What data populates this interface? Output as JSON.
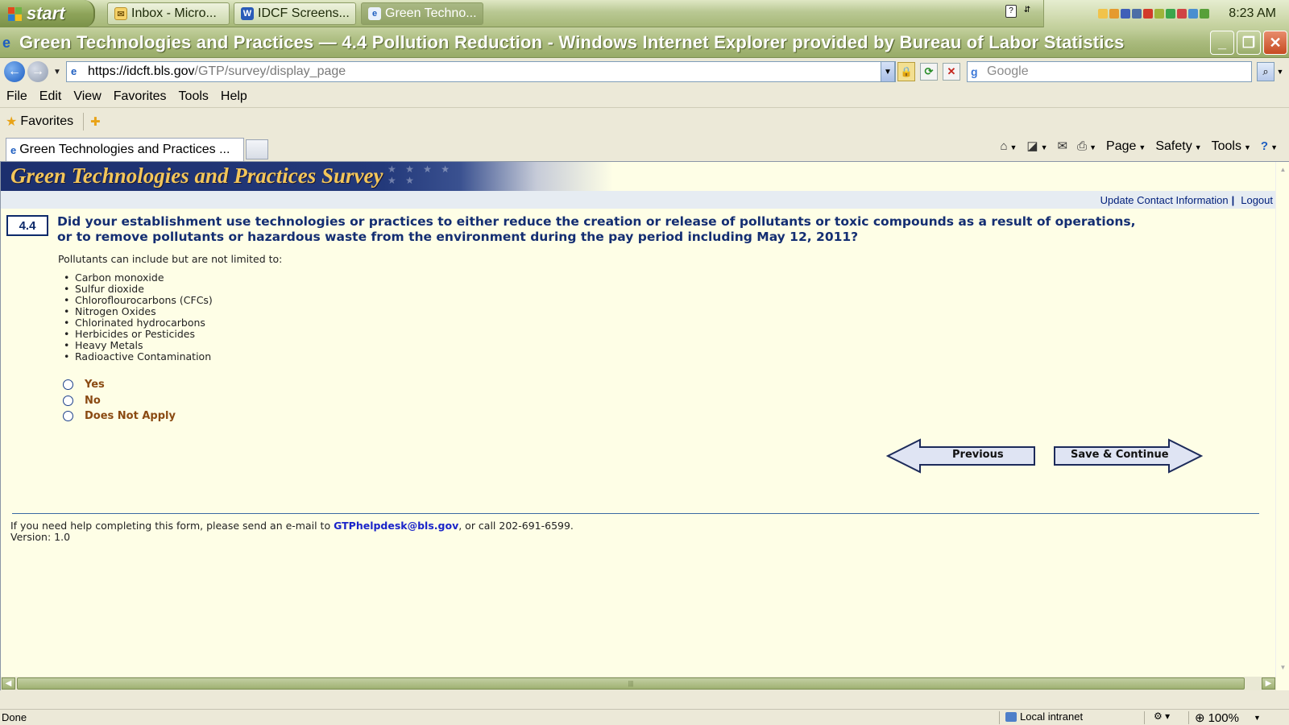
{
  "taskbar": {
    "start_label": "start",
    "tasks": [
      {
        "label": "Inbox - Micro...",
        "icon": "outlook-icon"
      },
      {
        "label": "IDCF Screens...",
        "icon": "word-icon"
      },
      {
        "label": "Green Techno...",
        "icon": "ie-icon"
      }
    ],
    "clock": "8:23 AM"
  },
  "window": {
    "title": "Green Technologies and Practices — 4.4 Pollution Reduction - Windows Internet Explorer provided by Bureau of Labor Statistics"
  },
  "address": {
    "host": "https://idcft.bls.gov",
    "path": "/GTP/survey/display_page",
    "search_placeholder": "Google"
  },
  "menu": [
    "File",
    "Edit",
    "View",
    "Favorites",
    "Tools",
    "Help"
  ],
  "favorites_label": "Favorites",
  "tab_label": "Green Technologies and Practices ...",
  "command_bar": {
    "page": "Page",
    "safety": "Safety",
    "tools": "Tools"
  },
  "page": {
    "banner_title": "Green Technologies and Practices Survey",
    "update_contact": "Update Contact Information",
    "pipe": "|",
    "logout": "Logout",
    "question_number": "4.4",
    "question_text": "Did your establishment use technologies or practices to either reduce the creation or release of pollutants or toxic compounds as a result of operations, or to remove pollutants or hazardous waste from the environment during the pay period including May 12, 2011?",
    "pollutants_intro": "Pollutants can include but are not limited to:",
    "pollutants": [
      "Carbon monoxide",
      "Sulfur dioxide",
      "Chloroflourocarbons (CFCs)",
      "Nitrogen Oxides",
      "Chlorinated hydrocarbons",
      "Herbicides or Pesticides",
      "Heavy Metals",
      "Radioactive Contamination"
    ],
    "options": [
      "Yes",
      "No",
      "Does Not Apply"
    ],
    "previous_label": "Previous",
    "save_label": "Save & Continue",
    "help_prefix": "If you need help completing this form, please send an e-mail to ",
    "help_email": "GTPhelpdesk@bls.gov",
    "help_suffix": ", or call 202-691-6599.",
    "version": "Version: 1.0"
  },
  "status": {
    "left": "Done",
    "zone": "Local intranet",
    "zoom": "100%"
  }
}
